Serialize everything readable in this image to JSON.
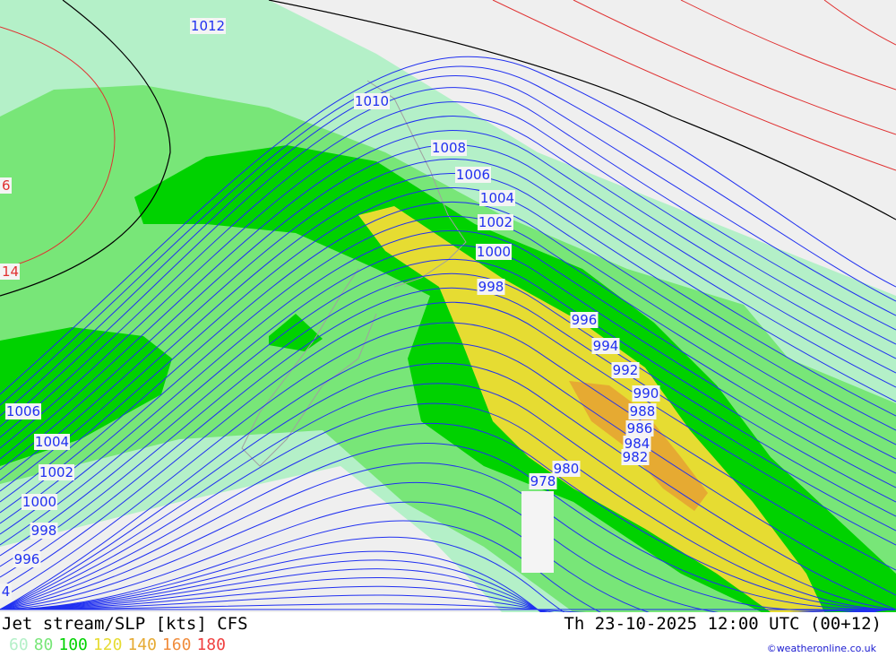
{
  "title": "Jet stream/SLP [kts] CFS",
  "datetime": "Th 23-10-2025 12:00 UTC (00+12)",
  "credit": "©weatheronline.co.uk",
  "legend": [
    {
      "label": "60",
      "color": "#b4f0c8"
    },
    {
      "label": "80",
      "color": "#78e678"
    },
    {
      "label": "100",
      "color": "#00d200"
    },
    {
      "label": "120",
      "color": "#e6dc32"
    },
    {
      "label": "140",
      "color": "#e6aa32"
    },
    {
      "label": "160",
      "color": "#f08c3c"
    },
    {
      "label": "180",
      "color": "#f04040"
    }
  ],
  "isobar_labels": [
    "1012",
    "1010",
    "1008",
    "1006",
    "1004",
    "1002",
    "1000",
    "998",
    "996",
    "994",
    "992",
    "990",
    "988",
    "986",
    "984",
    "982",
    "980",
    "978",
    "1006",
    "1004",
    "1002",
    "1000",
    "998",
    "996",
    "4"
  ],
  "red_labels": [
    "6",
    "14"
  ]
}
